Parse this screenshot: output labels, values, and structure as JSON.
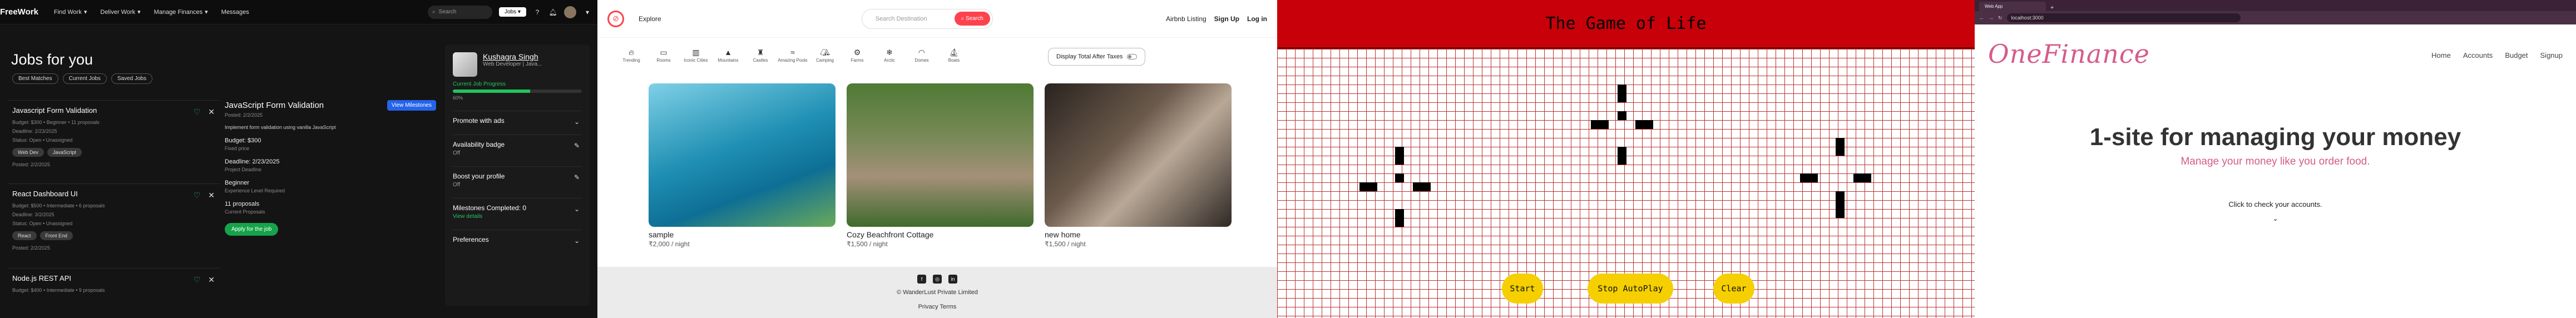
{
  "freework": {
    "logo": "FreeWork",
    "nav": [
      "Find Work",
      "Deliver Work",
      "Manage Finances",
      "Messages"
    ],
    "search_placeholder": "Search",
    "search_scope": "Jobs",
    "page_title": "Jobs for you",
    "filters": [
      "Best Matches",
      "Current Jobs",
      "Saved Jobs"
    ],
    "jobs": [
      {
        "title": "Javascript Form Validation",
        "lines": [
          "Budget: $300 • Beginner • 11 proposals",
          "Deadline: 2/23/2025",
          "Status: Open • Unassigned"
        ],
        "tags": [
          "Web Dev",
          "JavaScript"
        ],
        "posted": "Posted: 2/2/2025"
      },
      {
        "title": "React Dashboard UI",
        "lines": [
          "Budget: $500 • Intermediate • 6 proposals",
          "Deadline: 3/2/2025",
          "Status: Open • Unassigned"
        ],
        "tags": [
          "React",
          "Front End"
        ],
        "posted": "Posted: 2/2/2025"
      },
      {
        "title": "Node.js REST API",
        "lines": [
          "Budget: $400 • Intermediate • 9 proposals"
        ],
        "tags": [],
        "posted": ""
      }
    ],
    "detail": {
      "title": "JavaScript Form Validation",
      "view_button": "View Milestones",
      "posted": "Posted: 2/2/2025",
      "desc": "Implement form validation using vanilla JavaScript",
      "budget": "Budget: $300",
      "budget_sub": "Fixed price",
      "deadline": "Deadline: 2/23/2025",
      "deadline_sub": "Project Deadline",
      "level": "Beginner",
      "level_sub": "Experience Level Required",
      "proposals": "11 proposals",
      "proposals_sub": "Current Proposals",
      "apply": "Apply for the job"
    },
    "profile": {
      "name": "Kushagra Singh",
      "role": "Web Developer | Java...",
      "progress_label": "Current Job Progress",
      "progress": 0.6,
      "progress_text": "60%",
      "sections": [
        {
          "title": "Promote with ads",
          "sub": "",
          "icon": "chevron-down-icon"
        },
        {
          "title": "Availability badge",
          "sub": "Off",
          "icon": "pencil-icon"
        },
        {
          "title": "Boost your profile",
          "sub": "Off",
          "icon": "pencil-icon"
        },
        {
          "title": "Milestones Completed: 0",
          "sub": "View details",
          "icon": "chevron-down-icon"
        },
        {
          "title": "Preferences",
          "sub": "",
          "icon": "chevron-down-icon"
        }
      ]
    }
  },
  "wanderlust": {
    "explore": "Explore",
    "search_placeholder": "Search Destination",
    "search_button": "Search",
    "links": [
      "Airbnb Listing",
      "Sign Up",
      "Log in"
    ],
    "categories": [
      "Trending",
      "Rooms",
      "Iconic Cities",
      "Mountains",
      "Castles",
      "Amazing Pools",
      "Camping",
      "Farms",
      "Arctic",
      "Domes",
      "Boats"
    ],
    "tax_toggle": "Display Total After Taxes",
    "listings": [
      {
        "name": "sample",
        "price": "₹2,000 / night",
        "color": "#2f9ab6"
      },
      {
        "name": "Cozy Beachfront Cottage",
        "price": "₹1,500 / night",
        "color": "#5b7c3e"
      },
      {
        "name": "new home",
        "price": "₹1,500 / night",
        "color": "#4a3f38"
      }
    ],
    "copyright": "© WanderLust Private Limited",
    "footer_links": "Privacy Terms"
  },
  "life": {
    "title": "The Game of Life",
    "buttons": [
      "Start",
      "Stop AutoPlay",
      "Clear"
    ],
    "accent": "#c8000a"
  },
  "finance": {
    "tab_label": "Web App",
    "url": "localhost:3000",
    "brand": "OneFinance",
    "nav": [
      "Home",
      "Accounts",
      "Budget",
      "Signup"
    ],
    "hero": "1-site for managing your money",
    "tagline": "Manage your money like you order food.",
    "cta": "Click to check your accounts.",
    "accent": "#d65b8b"
  }
}
